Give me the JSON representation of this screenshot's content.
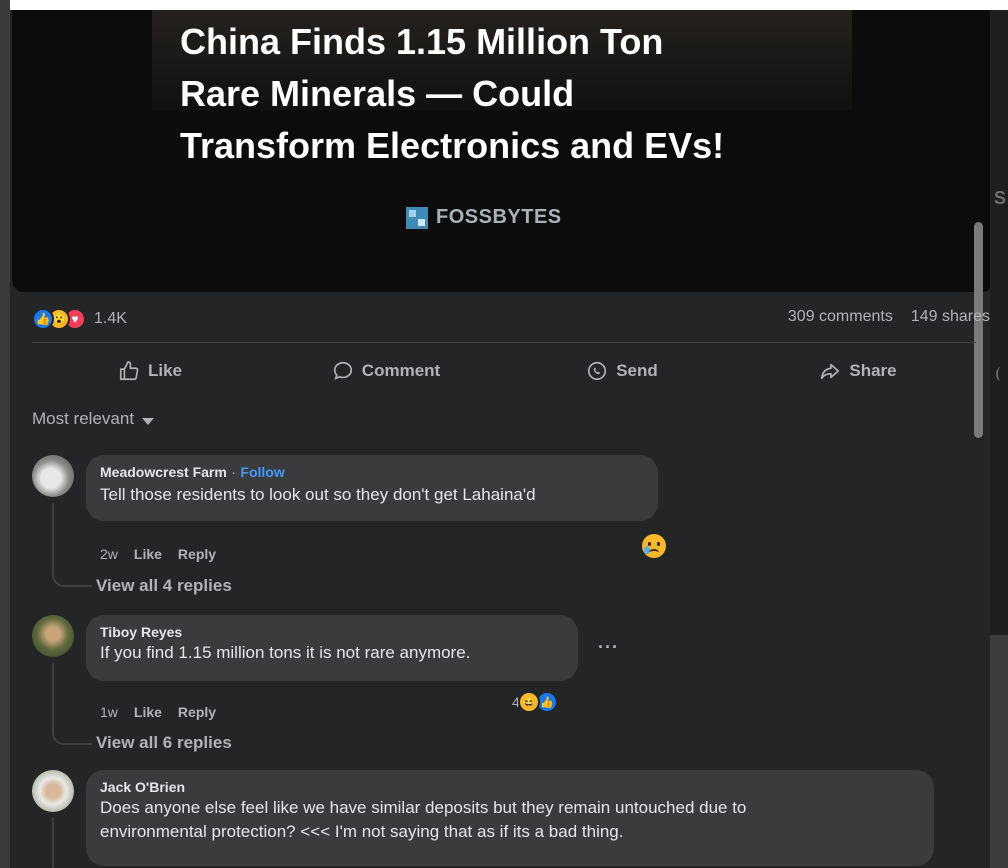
{
  "hero": {
    "headline_lines": [
      "China Finds 1.15 Million Ton",
      "Rare Minerals — Could",
      "Transform Electronics and EVs!"
    ],
    "brand": "FOSSBYTES"
  },
  "side": {
    "letter": "S"
  },
  "stats": {
    "reaction_count": "1.4K",
    "comments": "309 comments",
    "shares": "149 shares"
  },
  "actions": [
    {
      "label": "Like",
      "icon": "thumbs-up-icon"
    },
    {
      "label": "Comment",
      "icon": "comment-bubble-icon"
    },
    {
      "label": "Send",
      "icon": "messenger-icon"
    },
    {
      "label": "Share",
      "icon": "share-arrow-icon"
    }
  ],
  "sort": {
    "label": "Most relevant"
  },
  "comments": [
    {
      "author": "Meadowcrest Farm",
      "separator": "·",
      "follow": "Follow",
      "text": "Tell those residents to look out so they don't get Lahaina'd",
      "time": "2w",
      "like": "Like",
      "reply": "Reply",
      "reaction_icon": "sad-face-icon",
      "replies": "View all 4 replies"
    },
    {
      "author": "Tiboy Reyes",
      "text": "If you find 1.15 million tons it is not rare anymore.",
      "time": "1w",
      "like": "Like",
      "reply": "Reply",
      "reaction_count": "4",
      "reaction_icons": [
        "haha-icon",
        "like-icon"
      ],
      "more": "···",
      "replies": "View all 6 replies"
    },
    {
      "author": "Jack O'Brien",
      "text_lines": [
        "Does anyone else feel like we have similar deposits but they remain untouched due to",
        "environmental protection? <<< I'm not saying that as if its a bad thing."
      ]
    }
  ]
}
